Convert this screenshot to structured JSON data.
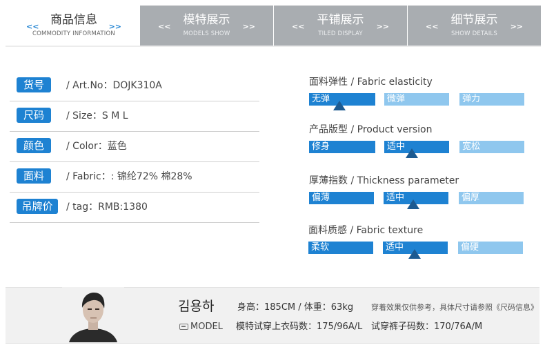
{
  "tabs": [
    {
      "cn": "商品信息",
      "en": "COMMODITY INFORMATION",
      "state": "active"
    },
    {
      "cn": "模特展示",
      "en": "MODELS SHOW",
      "state": "inactive"
    },
    {
      "cn": "平铺展示",
      "en": "TILED DISPLAY",
      "state": "inactive"
    },
    {
      "cn": "细节展示",
      "en": "SHOW DETAILS",
      "state": "inactive"
    }
  ],
  "arrows": {
    "left": "<<",
    "right": ">>"
  },
  "info": [
    {
      "badge": "货号",
      "text": "/ Art.No：DOJK310A"
    },
    {
      "badge": "尺码",
      "text": "/ Size：S M L"
    },
    {
      "badge": "颜色",
      "text": "/ Color：蓝色"
    },
    {
      "badge": "面料",
      "text": "/ Fabric：:  锦纶72%  棉28%"
    },
    {
      "badge": "吊牌价",
      "text": "/ tag：RMB:1380"
    }
  ],
  "scales": [
    {
      "title": "面料弹性 / Fabric elasticity",
      "options": [
        "无弹",
        "微弹",
        "弹力"
      ],
      "selected": "无弹"
    },
    {
      "title": "产品版型 / Product version",
      "options": [
        "修身",
        "适中",
        "宽松"
      ],
      "selected": "适中"
    },
    {
      "title": "厚薄指数 / Thickness parameter",
      "options": [
        "偏薄",
        "适中",
        "偏厚"
      ],
      "selected": "适中"
    },
    {
      "title": "面料质感 / Fabric texture",
      "options": [
        "柔软",
        "适中",
        "偏硬"
      ],
      "selected": "适中"
    }
  ],
  "model": {
    "name": "김용하",
    "stats": "身高：185CM  /  体重：63kg",
    "note": "穿着效果仅供参考，具体尺寸请参照《尺码信息》",
    "label": "MODEL",
    "top_size": "模特试穿上衣码数：175/96A/L",
    "bottom_size": "试穿裤子码数：170/76A/M"
  },
  "colors": {
    "accent": "#1e82d2",
    "accent_light": "#8fc7ee",
    "marker": "#1c5a91",
    "tab_inactive": "#a9adb1"
  }
}
